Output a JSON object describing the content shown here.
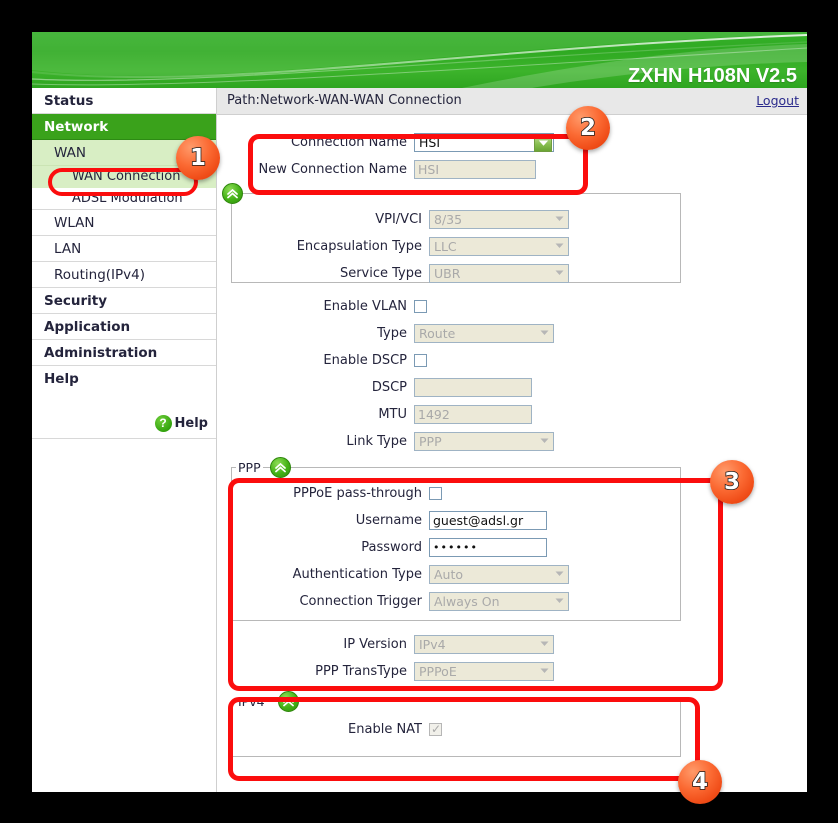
{
  "header": {
    "model": "ZXHN H108N V2.5"
  },
  "pathbar": {
    "path": "Path:Network-WAN-WAN Connection",
    "logout": "Logout"
  },
  "sidebar": {
    "items": [
      {
        "label": "Status",
        "level": "top",
        "active": false
      },
      {
        "label": "Network",
        "level": "top",
        "active": true
      },
      {
        "label": "WAN",
        "level": "sub",
        "active": false
      },
      {
        "label": "WAN Connection",
        "level": "sub2",
        "active": true
      },
      {
        "label": "ADSL Modulation",
        "level": "sub2",
        "active": false
      },
      {
        "label": "WLAN",
        "level": "sub",
        "active": false
      },
      {
        "label": "LAN",
        "level": "sub",
        "active": false
      },
      {
        "label": "Routing(IPv4)",
        "level": "sub",
        "active": false
      },
      {
        "label": "Security",
        "level": "top",
        "active": false
      },
      {
        "label": "Application",
        "level": "top",
        "active": false
      },
      {
        "label": "Administration",
        "level": "top",
        "active": false
      },
      {
        "label": "Help",
        "level": "top",
        "active": false
      }
    ],
    "help": {
      "icon": "question-mark-icon",
      "label": "Help"
    }
  },
  "form": {
    "connection_name": {
      "label": "Connection Name",
      "value": "HSI",
      "control": "select",
      "enabled": true
    },
    "new_connection_name": {
      "label": "New Connection Name",
      "value": "HSI",
      "control": "text",
      "enabled": false
    },
    "vpi_vci": {
      "label": "VPI/VCI",
      "value": "8/35",
      "control": "select",
      "enabled": false
    },
    "encapsulation_type": {
      "label": "Encapsulation Type",
      "value": "LLC",
      "control": "select",
      "enabled": false
    },
    "service_type": {
      "label": "Service Type",
      "value": "UBR",
      "control": "select",
      "enabled": false
    },
    "enable_vlan": {
      "label": "Enable VLAN",
      "checked": false,
      "control": "checkbox",
      "enabled": true
    },
    "type": {
      "label": "Type",
      "value": "Route",
      "control": "select",
      "enabled": false
    },
    "enable_dscp": {
      "label": "Enable DSCP",
      "checked": false,
      "control": "checkbox",
      "enabled": true
    },
    "dscp": {
      "label": "DSCP",
      "value": "",
      "control": "text",
      "enabled": false
    },
    "mtu": {
      "label": "MTU",
      "value": "1492",
      "control": "text",
      "enabled": false
    },
    "link_type": {
      "label": "Link Type",
      "value": "PPP",
      "control": "select",
      "enabled": false
    },
    "ppp_legend": "PPP",
    "pppoe_pass_through": {
      "label": "PPPoE pass-through",
      "checked": false,
      "control": "checkbox",
      "enabled": true
    },
    "username": {
      "label": "Username",
      "value": "guest@adsl.gr",
      "control": "text",
      "enabled": true
    },
    "password": {
      "label": "Password",
      "value": "••••••",
      "control": "password",
      "enabled": true
    },
    "authentication_type": {
      "label": "Authentication Type",
      "value": "Auto",
      "control": "select",
      "enabled": false
    },
    "connection_trigger": {
      "label": "Connection Trigger",
      "value": "Always On",
      "control": "select",
      "enabled": false
    },
    "ip_version": {
      "label": "IP Version",
      "value": "IPv4",
      "control": "select",
      "enabled": false
    },
    "ppp_transtype": {
      "label": "PPP TransType",
      "value": "PPPoE",
      "control": "select",
      "enabled": false
    },
    "ipv4_legend": "IPv4",
    "enable_nat": {
      "label": "Enable NAT",
      "checked": true,
      "control": "checkbox",
      "enabled": false
    }
  },
  "annotations": {
    "badges": [
      {
        "number": "1",
        "target": "sidebar-wan-connection"
      },
      {
        "number": "2",
        "target": "connection-name-group"
      },
      {
        "number": "3",
        "target": "ppp-group"
      },
      {
        "number": "4",
        "target": "ipv4-group"
      }
    ],
    "highlight_color": "#fb0d0d",
    "badge_color": "#f04d18"
  },
  "icons": {
    "collapse": "chevron-double-up-icon",
    "dropdown": "chevron-down-icon"
  }
}
